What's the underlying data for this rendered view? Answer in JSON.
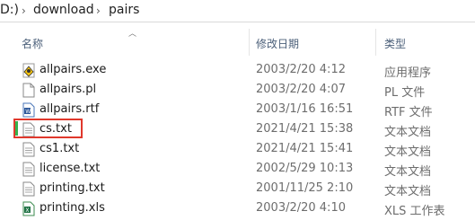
{
  "breadcrumb": {
    "drive": "D:)",
    "folder1": "download",
    "folder2": "pairs"
  },
  "columns": {
    "name": "名称",
    "modified": "修改日期",
    "type": "类型"
  },
  "files": [
    {
      "name": "allpairs.exe",
      "modified": "2003/2/20 4:12",
      "type": "应用程序",
      "icon": "exe-icon"
    },
    {
      "name": "allpairs.pl",
      "modified": "2003/2/20 4:07",
      "type": "PL 文件",
      "icon": "file-icon"
    },
    {
      "name": "allpairs.rtf",
      "modified": "2003/1/16 16:51",
      "type": "RTF 文件",
      "icon": "word-doc-icon"
    },
    {
      "name": "cs.txt",
      "modified": "2021/4/21 15:38",
      "type": "文本文档",
      "icon": "text-file-icon"
    },
    {
      "name": "cs1.txt",
      "modified": "2021/4/21 15:41",
      "type": "文本文档",
      "icon": "text-file-icon"
    },
    {
      "name": "license.txt",
      "modified": "2002/5/29 10:13",
      "type": "文本文档",
      "icon": "text-file-icon"
    },
    {
      "name": "printing.txt",
      "modified": "2001/11/25 2:10",
      "type": "文本文档",
      "icon": "text-file-icon"
    },
    {
      "name": "printing.xls",
      "modified": "2003/2/20 4:10",
      "type": "XLS 工作表",
      "icon": "excel-icon"
    }
  ],
  "colors": {
    "highlight": "#e0382c",
    "accent_bar": "#37b24d"
  }
}
